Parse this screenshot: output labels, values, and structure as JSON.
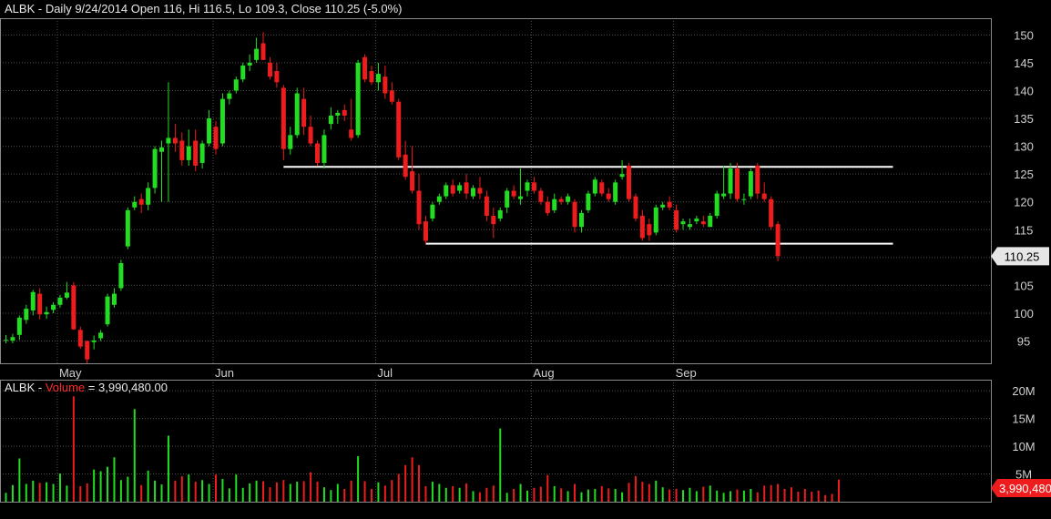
{
  "header": {
    "symbol": "ALBK",
    "sep": " - ",
    "summary": "Daily 9/24/2014 Open 116, Hi 116.5, Lo 109.3, Close 110.25 (-5.0%)"
  },
  "volume_header": {
    "symbol": "ALBK",
    "sep1": " - ",
    "label": "Volume",
    "sep2": " = ",
    "value": "3,990,480.00"
  },
  "colors": {
    "up": "#22dd22",
    "down": "#ee1c1c",
    "grid": "#4d4d4d",
    "axis_text": "#d0d0d0",
    "level_line": "#ffffff",
    "price_badge_bg": "#e6e6e6",
    "volume_badge_bg": "#ee1c1c"
  },
  "badges": {
    "last_price": "110.25",
    "last_volume": "3,990,480"
  },
  "chart_data": [
    {
      "type": "candlestick",
      "title": "ALBK - Daily 9/24/2014 Open 116, Hi 116.5, Lo 109.3, Close 110.25 (-5.0%)",
      "ylim": [
        91,
        153
      ],
      "y_ticks": [
        95,
        100,
        105,
        110,
        115,
        120,
        125,
        130,
        135,
        140,
        145,
        150
      ],
      "x_tick_labels": [
        {
          "label": "May",
          "index": 8
        },
        {
          "label": "Jun",
          "index": 31
        },
        {
          "label": "Jul",
          "index": 55
        },
        {
          "label": "Aug",
          "index": 78
        },
        {
          "label": "Sep",
          "index": 99
        }
      ],
      "grid": true,
      "ohlc": [
        [
          95.2,
          96.1,
          94.6,
          95.2
        ],
        [
          95.1,
          96.3,
          94.6,
          95.7
        ],
        [
          96.1,
          99.6,
          95.2,
          99.2
        ],
        [
          98.8,
          101.5,
          98.1,
          100.8
        ],
        [
          100.5,
          104.2,
          99.6,
          103.8
        ],
        [
          103.5,
          104.5,
          98.9,
          99.8
        ],
        [
          99.8,
          101.2,
          99.0,
          100.2
        ],
        [
          100.6,
          102.0,
          100.0,
          101.5
        ],
        [
          101.5,
          103.3,
          101.0,
          102.8
        ],
        [
          102.8,
          105.6,
          102.5,
          103.7
        ],
        [
          105.0,
          105.6,
          97.0,
          97.1
        ],
        [
          97.0,
          97.6,
          93.6,
          94.0
        ],
        [
          95.0,
          95.1,
          91.0,
          91.7
        ],
        [
          94.8,
          96.0,
          93.5,
          95.1
        ],
        [
          95.5,
          97.0,
          95.0,
          96.5
        ],
        [
          98.0,
          103.5,
          97.6,
          103.0
        ],
        [
          101.5,
          104.5,
          101.0,
          103.5
        ],
        [
          104.5,
          109.6,
          104.0,
          109.0
        ],
        [
          112.0,
          119.0,
          111.5,
          118.5
        ],
        [
          119.0,
          121.0,
          118.5,
          120.0
        ],
        [
          120.5,
          121.5,
          118.0,
          119.5
        ],
        [
          119.5,
          123.5,
          118.5,
          122.5
        ],
        [
          122.5,
          130.0,
          121.5,
          129.5
        ],
        [
          129.0,
          131.0,
          120.0,
          129.8
        ],
        [
          130.5,
          141.5,
          120.0,
          131.5
        ],
        [
          131.5,
          134.0,
          129.0,
          130.5
        ],
        [
          131.0,
          132.5,
          126.5,
          127.5
        ],
        [
          127.5,
          133.0,
          126.5,
          130.0
        ],
        [
          131.0,
          133.0,
          125.5,
          126.5
        ],
        [
          127.0,
          131.0,
          126.0,
          130.5
        ],
        [
          130.5,
          136.5,
          130.0,
          135.0
        ],
        [
          133.5,
          134.5,
          128.5,
          129.5
        ],
        [
          130.5,
          139.5,
          130.0,
          138.5
        ],
        [
          138.5,
          140.0,
          137.5,
          139.5
        ],
        [
          140.0,
          142.5,
          139.5,
          142.0
        ],
        [
          142.0,
          145.0,
          141.5,
          144.5
        ],
        [
          144.5,
          146.5,
          143.5,
          145.0
        ],
        [
          145.5,
          149.5,
          145.0,
          147.5
        ],
        [
          148.5,
          150.5,
          145.5,
          145.5
        ],
        [
          145.0,
          146.0,
          142.0,
          142.5
        ],
        [
          143.5,
          145.0,
          140.5,
          141.5
        ],
        [
          140.5,
          141.0,
          127.5,
          129.5
        ],
        [
          129.5,
          133.5,
          128.5,
          132.0
        ],
        [
          132.0,
          140.5,
          131.5,
          139.5
        ],
        [
          138.5,
          140.5,
          132.0,
          133.5
        ],
        [
          133.5,
          135.5,
          130.0,
          130.5
        ],
        [
          130.5,
          131.0,
          126.5,
          127.0
        ],
        [
          127.0,
          133.0,
          126.0,
          132.0
        ],
        [
          134.0,
          137.0,
          133.0,
          135.5
        ],
        [
          135.5,
          136.5,
          134.0,
          136.0
        ],
        [
          136.5,
          137.5,
          134.5,
          135.5
        ],
        [
          133.0,
          138.5,
          131.0,
          131.5
        ],
        [
          132.0,
          145.5,
          131.5,
          145.0
        ],
        [
          146.0,
          146.5,
          141.5,
          142.0
        ],
        [
          143.5,
          144.5,
          141.0,
          141.5
        ],
        [
          141.5,
          145.0,
          140.0,
          143.0
        ],
        [
          142.5,
          144.5,
          138.5,
          139.5
        ],
        [
          140.0,
          141.5,
          137.5,
          138.0
        ],
        [
          138.0,
          138.5,
          127.5,
          128.0
        ],
        [
          128.5,
          131.0,
          124.0,
          124.5
        ],
        [
          125.5,
          130.0,
          121.5,
          122.0
        ],
        [
          122.0,
          125.0,
          115.0,
          116.0
        ],
        [
          116.5,
          117.5,
          112.5,
          113.0
        ],
        [
          117.0,
          120.0,
          116.5,
          119.5
        ],
        [
          120.0,
          121.5,
          119.5,
          121.0
        ],
        [
          121.0,
          123.5,
          120.5,
          123.0
        ],
        [
          123.0,
          124.0,
          121.0,
          121.5
        ],
        [
          122.0,
          123.5,
          121.5,
          123.0
        ],
        [
          123.5,
          125.0,
          120.5,
          121.5
        ],
        [
          121.0,
          123.0,
          120.5,
          122.5
        ],
        [
          122.5,
          124.5,
          120.5,
          121.5
        ],
        [
          121.0,
          122.0,
          116.5,
          117.5
        ],
        [
          117.5,
          119.0,
          113.5,
          116.0
        ],
        [
          117.0,
          119.0,
          116.5,
          118.5
        ],
        [
          119.0,
          122.5,
          118.0,
          122.0
        ],
        [
          122.0,
          123.0,
          120.5,
          121.0
        ],
        [
          120.5,
          126.0,
          119.5,
          121.0
        ],
        [
          122.0,
          124.0,
          121.0,
          123.5
        ],
        [
          123.5,
          124.5,
          121.5,
          122.0
        ],
        [
          122.0,
          122.5,
          119.5,
          120.0
        ],
        [
          120.0,
          121.0,
          117.5,
          118.0
        ],
        [
          118.5,
          121.5,
          118.0,
          120.5
        ],
        [
          120.5,
          121.0,
          119.5,
          120.0
        ],
        [
          120.0,
          121.5,
          119.5,
          121.0
        ],
        [
          120.0,
          120.5,
          114.5,
          115.5
        ],
        [
          115.5,
          118.5,
          114.5,
          118.0
        ],
        [
          118.5,
          122.0,
          118.0,
          121.5
        ],
        [
          121.5,
          124.5,
          121.0,
          124.0
        ],
        [
          123.5,
          124.0,
          121.0,
          121.5
        ],
        [
          121.5,
          122.5,
          120.0,
          120.5
        ],
        [
          120.0,
          124.0,
          119.5,
          123.5
        ],
        [
          124.5,
          127.5,
          124.0,
          125.0
        ],
        [
          126.5,
          127.0,
          120.0,
          120.5
        ],
        [
          121.0,
          121.5,
          116.5,
          117.0
        ],
        [
          117.5,
          118.5,
          113.0,
          113.5
        ],
        [
          116.0,
          117.0,
          113.0,
          114.0
        ],
        [
          114.5,
          119.5,
          114.0,
          119.0
        ],
        [
          119.0,
          120.0,
          118.5,
          119.5
        ],
        [
          120.0,
          121.0,
          118.5,
          119.0
        ],
        [
          118.5,
          119.5,
          114.5,
          115.0
        ],
        [
          116.0,
          117.0,
          115.0,
          116.5
        ],
        [
          115.5,
          117.0,
          115.0,
          116.0
        ],
        [
          116.5,
          117.5,
          116.0,
          117.0
        ],
        [
          116.5,
          117.5,
          115.5,
          116.0
        ],
        [
          115.5,
          118.0,
          115.5,
          117.5
        ],
        [
          117.5,
          122.0,
          117.0,
          121.5
        ],
        [
          121.0,
          126.5,
          120.5,
          121.5
        ],
        [
          121.5,
          127.0,
          120.5,
          126.0
        ],
        [
          126.0,
          127.0,
          120.0,
          120.5
        ],
        [
          120.5,
          121.5,
          119.5,
          120.5
        ],
        [
          121.0,
          126.0,
          120.5,
          125.5
        ],
        [
          126.5,
          127.0,
          120.5,
          121.5
        ],
        [
          121.5,
          123.5,
          120.0,
          120.5
        ],
        [
          120.5,
          121.0,
          115.0,
          115.5
        ],
        [
          116.0,
          116.5,
          109.3,
          110.25
        ]
      ],
      "horizontal_lines": [
        {
          "y": 126.3,
          "from_index": 41,
          "to_index": 131
        },
        {
          "y": 112.5,
          "from_index": 62,
          "to_index": 131
        }
      ]
    },
    {
      "type": "bar",
      "title": "ALBK - Volume = 3,990,480.00",
      "ylabel": "Volume",
      "ylim": [
        0,
        22000000
      ],
      "y_ticks": [
        {
          "value": 20000000,
          "label": "20M"
        },
        {
          "value": 15000000,
          "label": "15M"
        },
        {
          "value": 10000000,
          "label": "10M"
        },
        {
          "value": 5000000,
          "label": "5M"
        }
      ],
      "values": [
        1600000,
        3000000,
        7800000,
        3200000,
        3800000,
        3400000,
        3500000,
        3200000,
        5100000,
        2900000,
        19000000,
        2800000,
        3300000,
        5800000,
        5500000,
        6300000,
        8000000,
        3900000,
        4500000,
        16700000,
        3000000,
        5600000,
        3800000,
        3100000,
        11900000,
        3800000,
        4600000,
        4900000,
        3600000,
        3900000,
        3200000,
        4900000,
        4100000,
        2400000,
        4900000,
        2500000,
        3300000,
        3800000,
        3700000,
        2600000,
        3500000,
        3900000,
        3200000,
        3600000,
        3700000,
        5300000,
        3600000,
        2600000,
        2100000,
        3200000,
        2300000,
        3800000,
        8200000,
        3700000,
        2300000,
        3500000,
        2900000,
        3900000,
        5000000,
        6600000,
        8000000,
        6600000,
        2800000,
        3600000,
        3200000,
        2500000,
        2800000,
        2500000,
        3300000,
        1900000,
        1700000,
        2500000,
        2900000,
        13200000,
        1600000,
        2300000,
        3200000,
        2000000,
        2500000,
        2700000,
        4800000,
        2800000,
        2400000,
        1900000,
        3200000,
        1700000,
        2200000,
        2300000,
        2800000,
        2400000,
        2300000,
        1700000,
        3400000,
        4600000,
        3600000,
        3200000,
        3800000,
        2600000,
        2200000,
        2300000,
        2100000,
        2500000,
        1900000,
        2700000,
        2900000,
        2000000,
        1600000,
        1900000,
        2200000,
        2000000,
        2300000,
        1700000,
        2900000,
        3000000,
        3200000,
        2300000,
        2600000,
        1800000,
        2300000,
        1800000,
        2000000,
        1200000,
        1400000,
        3990480
      ]
    }
  ]
}
